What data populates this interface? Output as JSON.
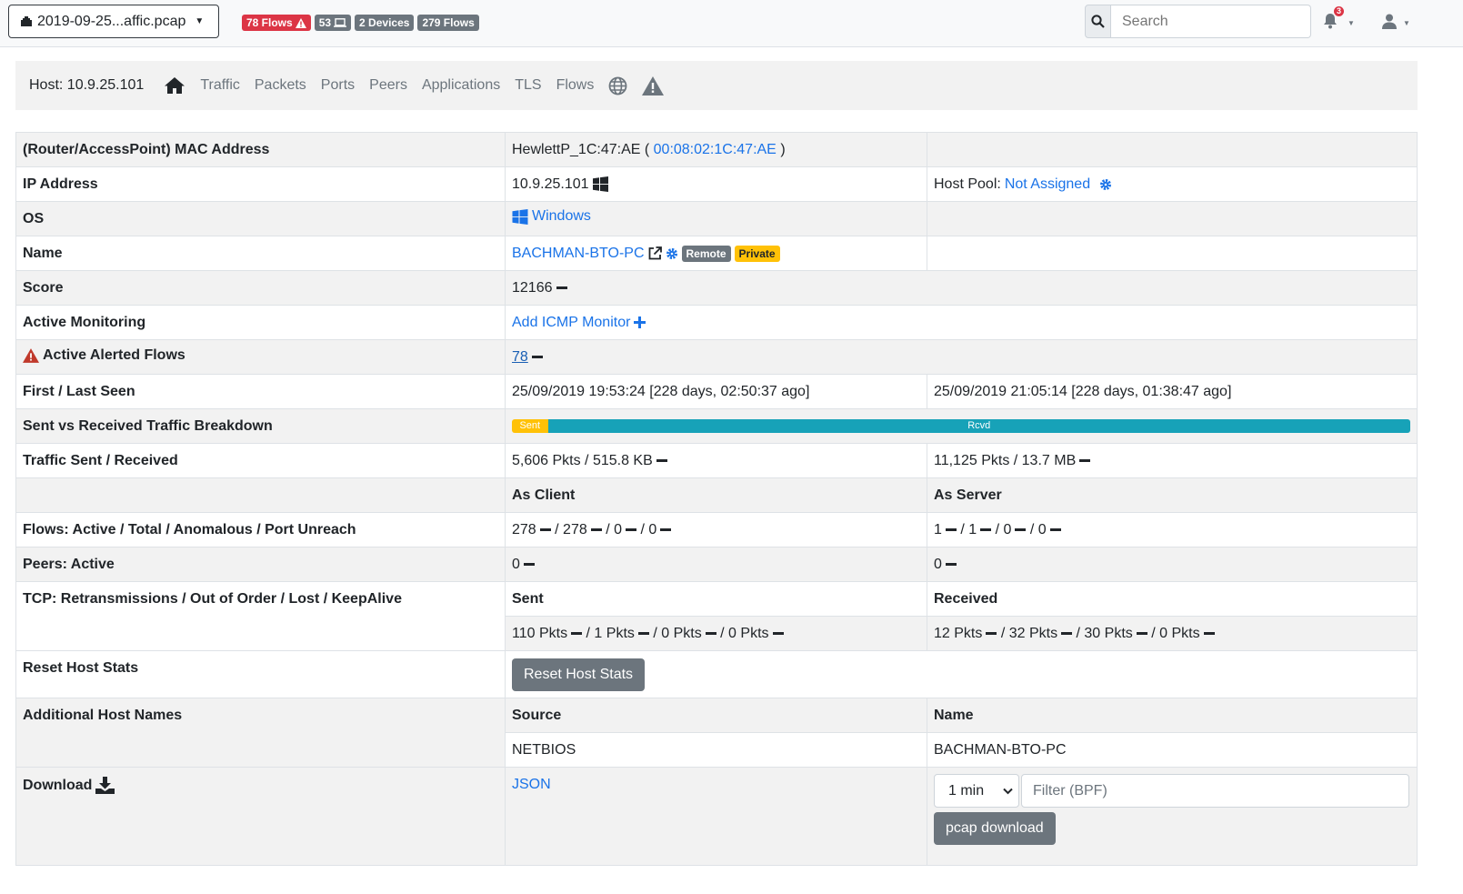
{
  "topbar": {
    "interface_name": "2019-09-25...affic.pcap",
    "badges": {
      "flows_alert": "78 Flows",
      "hosts": "53",
      "devices": "2 Devices",
      "flows": "279 Flows"
    },
    "search_placeholder": "Search",
    "notification_count": "3"
  },
  "hostnav": {
    "host_label": "Host: 10.9.25.101",
    "tabs": [
      "Traffic",
      "Packets",
      "Ports",
      "Peers",
      "Applications",
      "TLS",
      "Flows"
    ]
  },
  "rows": {
    "mac": {
      "label": "(Router/AccessPoint) MAC Address",
      "vendor": "HewlettP_1C:47:AE (",
      "mac_link": "00:08:02:1C:47:AE",
      "close": ")"
    },
    "ip": {
      "label": "IP Address",
      "value": "10.9.25.101",
      "pool_label": "Host Pool:",
      "pool_link": "Not Assigned"
    },
    "os": {
      "label": "OS",
      "value": "Windows"
    },
    "name": {
      "label": "Name",
      "value": "BACHMAN-BTO-PC",
      "badge_remote": "Remote",
      "badge_private": "Private"
    },
    "score": {
      "label": "Score",
      "value": "12166"
    },
    "monitoring": {
      "label": "Active Monitoring",
      "link": "Add ICMP Monitor"
    },
    "alerted": {
      "label": "Active Alerted Flows",
      "value": "78"
    },
    "seen": {
      "label": "First / Last Seen",
      "first": "25/09/2019 19:53:24 [228 days, 02:50:37 ago]",
      "last": "25/09/2019 21:05:14 [228 days, 01:38:47 ago]"
    },
    "breakdown": {
      "label": "Sent vs Received Traffic Breakdown",
      "sent": "Sent",
      "rcvd": "Rcvd",
      "sent_fraction": 0.04
    },
    "traffic": {
      "label": "Traffic Sent / Received",
      "sent": "5,606 Pkts / 515.8 KB",
      "received": "11,125 Pkts / 13.7 MB"
    },
    "role_header": {
      "client": "As Client",
      "server": "As Server"
    },
    "flows": {
      "label": "Flows: Active / Total / Anomalous / Port Unreach",
      "client": [
        "278",
        "/ 278",
        "/ 0",
        "/ 0"
      ],
      "server": [
        "1",
        "/ 1",
        "/ 0",
        "/ 0"
      ]
    },
    "peers": {
      "label": "Peers: Active",
      "client": "0",
      "server": "0"
    },
    "tcp": {
      "label": "TCP: Retransmissions / Out of Order / Lost / KeepAlive",
      "sent_header": "Sent",
      "received_header": "Received",
      "sent": [
        "110 Pkts",
        "/ 1 Pkts",
        "/ 0 Pkts",
        "/ 0 Pkts"
      ],
      "received": [
        "12 Pkts",
        "/ 32 Pkts",
        "/ 30 Pkts",
        "/ 0 Pkts"
      ]
    },
    "reset": {
      "label": "Reset Host Stats",
      "button": "Reset Host Stats"
    },
    "hostnames": {
      "label": "Additional Host Names",
      "source_header": "Source",
      "name_header": "Name",
      "source": "NETBIOS",
      "name": "BACHMAN-BTO-PC"
    },
    "download": {
      "label": "Download",
      "json_link": "JSON",
      "duration_selected": "1 min",
      "filter_placeholder": "Filter (BPF)",
      "pcap_button": "pcap download"
    }
  },
  "colors": {
    "danger": "#dc3545",
    "secondary": "#6c757d",
    "warning": "#ffc107",
    "info": "#17a2b8",
    "link": "#1a73e8"
  }
}
